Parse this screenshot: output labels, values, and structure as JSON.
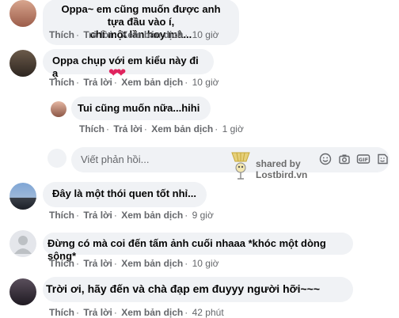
{
  "comments": [
    {
      "text_line1": "Oppa~ em cũng muốn được anh tựa đầu vào í,",
      "text_line2": "chỉ một lần hoy mà...",
      "like": "Thích",
      "reply": "Trả lời",
      "translate": "Xem bản dịch",
      "time": "10 giờ"
    },
    {
      "text": "Oppa chụp với em kiểu này đi ạ",
      "reaction": "❤❤",
      "like": "Thích",
      "reply": "Trả lời",
      "translate": "Xem bản dịch",
      "time": "10 giờ"
    },
    {
      "text": "Tui cũng muốn nữa...hihi",
      "like": "Thích",
      "reply": "Trả lời",
      "translate": "Xem bản dịch",
      "time": "1 giờ"
    },
    {
      "text": "Đây là một thói quen tốt nhỉ...",
      "like": "Thích",
      "reply": "Trả lời",
      "translate": "Xem bản dịch",
      "time": "9 giờ"
    },
    {
      "text": "Đừng có mà coi đến tấm ảnh cuối nhaaa *khóc một dòng sông*",
      "like": "Thích",
      "reply": "Trả lời",
      "translate": "Xem bản dịch",
      "time": "10 giờ"
    },
    {
      "text": "Trời ơi, hãy đến và chà đạp em đuyyy người hỡi~~~",
      "like": "Thích",
      "reply": "Trả lời",
      "translate": "Xem bản dịch",
      "time": "42 phút"
    }
  ],
  "reply_box": {
    "placeholder": "Viết phản hồi...",
    "icons": [
      "emoji-icon",
      "camera-icon",
      "gif-icon",
      "sticker-icon"
    ]
  },
  "watermark": {
    "line1": "shared by",
    "line2": "Lostbird.vn"
  },
  "colors": {
    "bubble": "#f0f2f5",
    "meta": "#65676b",
    "heart": "#e0245e"
  }
}
